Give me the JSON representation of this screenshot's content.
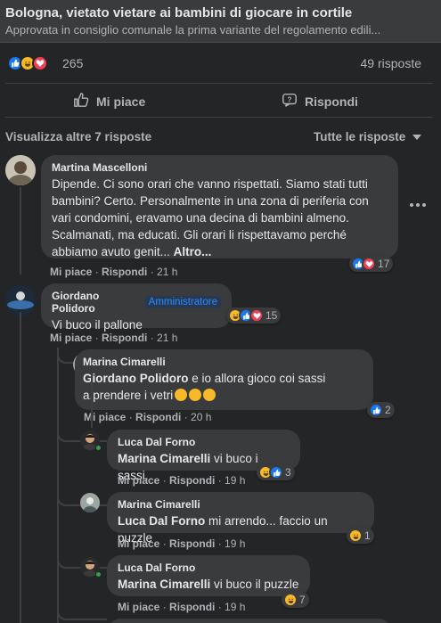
{
  "link_preview": {
    "title": "Bologna, vietato vietare ai bambini di giocare in cortile",
    "subtitle": "Approvata in consiglio comunale la prima variante del regolamento edili..."
  },
  "post_stats": {
    "reaction_count": "265",
    "replies_count": "49 risposte"
  },
  "actions": {
    "like_label": "Mi piace",
    "reply_label": "Rispondi"
  },
  "thread": {
    "view_more": "Visualizza altre 7 risposte",
    "filter_label": "Tutte le risposte"
  },
  "meta_labels": {
    "like": "Mi piace",
    "reply": "Rispondi",
    "sep": " · "
  },
  "comments": [
    {
      "author": "Martina Mascelloni",
      "text": "Dipende. Ci sono orari che vanno rispettati. Siamo stati tutti bambini? Certo. Personalmente in una zona di periferia con vari condomini, eravamo una decina di bambini almeno. Scalmanati, ma educati. Gli orari li rispettavamo perché abbiamo avuto genit...",
      "more": "Altro...",
      "time": "21 h",
      "reaction_count": "17"
    },
    {
      "author": "Giordano Polidoro",
      "badge": "Amministratore",
      "text": "Vi buco il pallone",
      "time": "21 h",
      "reaction_count": "15"
    },
    {
      "author": "Marina Cimarelli",
      "mention": "Giordano Polidoro",
      "text": " e io allora gioco coi sassi a.prendere i vetri",
      "time": "20 h",
      "reaction_count": "2"
    },
    {
      "author": "Luca Dal Forno",
      "mention": "Marina Cimarelli",
      "text": " vi buco i sassi.",
      "time": "19 h",
      "reaction_count": "3"
    },
    {
      "author": "Marina Cimarelli",
      "mention": "Luca Dal Forno",
      "text": " mi arrendo... faccio un puzzle",
      "time": "19 h",
      "reaction_count": "1"
    },
    {
      "author": "Luca Dal Forno",
      "mention": "Marina Cimarelli",
      "text": " vi buco il puzzle",
      "time": "19 h",
      "reaction_count": "7"
    }
  ],
  "colors": {
    "background": "#242526",
    "bubble": "#3a3b3c",
    "like": "#1877f2",
    "love": "#f33e58",
    "haha": "#f7b928",
    "admin_badge": "#2d88ff"
  }
}
